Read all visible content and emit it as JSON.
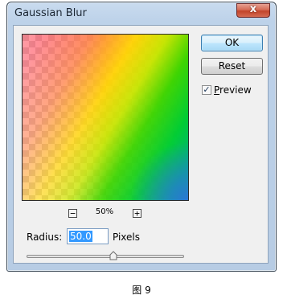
{
  "window": {
    "title": "Gaussian Blur",
    "close_glyph": "x"
  },
  "buttons": {
    "ok": "OK",
    "reset": "Reset"
  },
  "preview": {
    "label": "Preview",
    "checked": true,
    "zoom": "50%",
    "zoom_out_glyph": "−",
    "zoom_in_glyph": "+"
  },
  "radius": {
    "label": "Radius:",
    "value": "50.0",
    "unit": "Pixels",
    "slider_fraction": 0.55
  },
  "caption": "图 9",
  "colors": {
    "accent": "#3399ff",
    "close": "#c2442a"
  }
}
